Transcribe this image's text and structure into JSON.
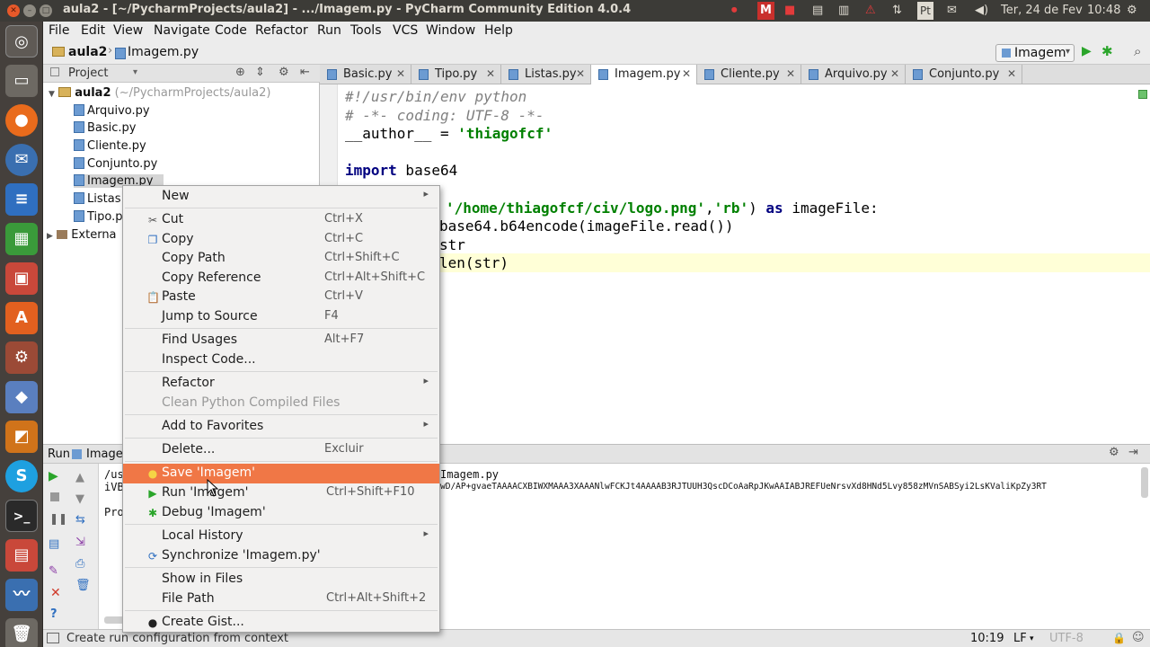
{
  "window_title": "aula2 - [~/PycharmProjects/aula2] - .../Imagem.py - PyCharm Community Edition 4.0.4",
  "system": {
    "date": "Ter, 24 de Fev",
    "time": "10:48",
    "keyboard": "Pt"
  },
  "menubar": [
    "File",
    "Edit",
    "View",
    "Navigate",
    "Code",
    "Refactor",
    "Run",
    "Tools",
    "VCS",
    "Window",
    "Help"
  ],
  "breadcrumb": {
    "project": "aula2",
    "file": "Imagem.py"
  },
  "run_config": "Imagem",
  "project_panel": {
    "title": "Project",
    "root": "aula2",
    "root_path": "(~/PycharmProjects/aula2)",
    "files": [
      "Arquivo.py",
      "Basic.py",
      "Cliente.py",
      "Conjunto.py",
      "Imagem.py",
      "Listas",
      "Tipo.p"
    ],
    "external": "Externa"
  },
  "tabs": [
    "Basic.py",
    "Tipo.py",
    "Listas.py",
    "Imagem.py",
    "Cliente.py",
    "Arquivo.py",
    "Conjunto.py"
  ],
  "code": {
    "l1": "#!/usr/bin/env python",
    "l2": "# -*- coding: UTF-8 -*-",
    "l3a": "__author__ = ",
    "l3b": "'thiagofcf'",
    "l5a": "import",
    "l5b": " base64",
    "l7a": "'/home/thiagofcf/civ/logo.png'",
    "l7b": ",",
    "l7c": "'rb'",
    "l7d": ") ",
    "l7e": "as",
    "l7f": " imageFile:",
    "l8": "base64.b64encode(imageFile.read())",
    "l9": "str",
    "l10": "len(str)"
  },
  "run_panel": {
    "title": "Run",
    "config": "Imagem",
    "line1_left": "/us",
    "line1_right": "Imagem.py",
    "line2_left": "iVB",
    "line2_right": "wD/AP+gvaeTAAAACXBIWXMAAA3XAAANlwFCKJt4AAAAB3RJTUUH3QscDCoAaRpJKwAAIABJREFUeNrsvXd8HNd5Lvy858zMVnSABSyi2LsKValiKpZy3RT",
    "line3_left": "Pro"
  },
  "status": {
    "message": "Create run configuration from context",
    "position": "10:19",
    "line_sep": "LF",
    "encoding": "UTF-8"
  },
  "context_menu": {
    "new": "New",
    "cut": {
      "label": "Cut",
      "shortcut": "Ctrl+X"
    },
    "copy": {
      "label": "Copy",
      "shortcut": "Ctrl+C"
    },
    "copy_path": {
      "label": "Copy Path",
      "shortcut": "Ctrl+Shift+C"
    },
    "copy_reference": {
      "label": "Copy Reference",
      "shortcut": "Ctrl+Alt+Shift+C"
    },
    "paste": {
      "label": "Paste",
      "shortcut": "Ctrl+V"
    },
    "jump_to_source": {
      "label": "Jump to Source",
      "shortcut": "F4"
    },
    "find_usages": {
      "label": "Find Usages",
      "shortcut": "Alt+F7"
    },
    "inspect_code": "Inspect Code...",
    "refactor": "Refactor",
    "clean_python": "Clean Python Compiled Files",
    "add_to_favorites": "Add to Favorites",
    "delete": {
      "label": "Delete...",
      "shortcut": "Excluir"
    },
    "save": "Save 'Imagem'",
    "run": {
      "label": "Run 'Imagem'",
      "shortcut": "Ctrl+Shift+F10"
    },
    "debug": "Debug 'Imagem'",
    "local_history": "Local History",
    "synchronize": "Synchronize 'Imagem.py'",
    "show_in_files": "Show in Files",
    "file_path": {
      "label": "File Path",
      "shortcut": "Ctrl+Alt+Shift+2"
    },
    "create_gist": "Create Gist..."
  }
}
